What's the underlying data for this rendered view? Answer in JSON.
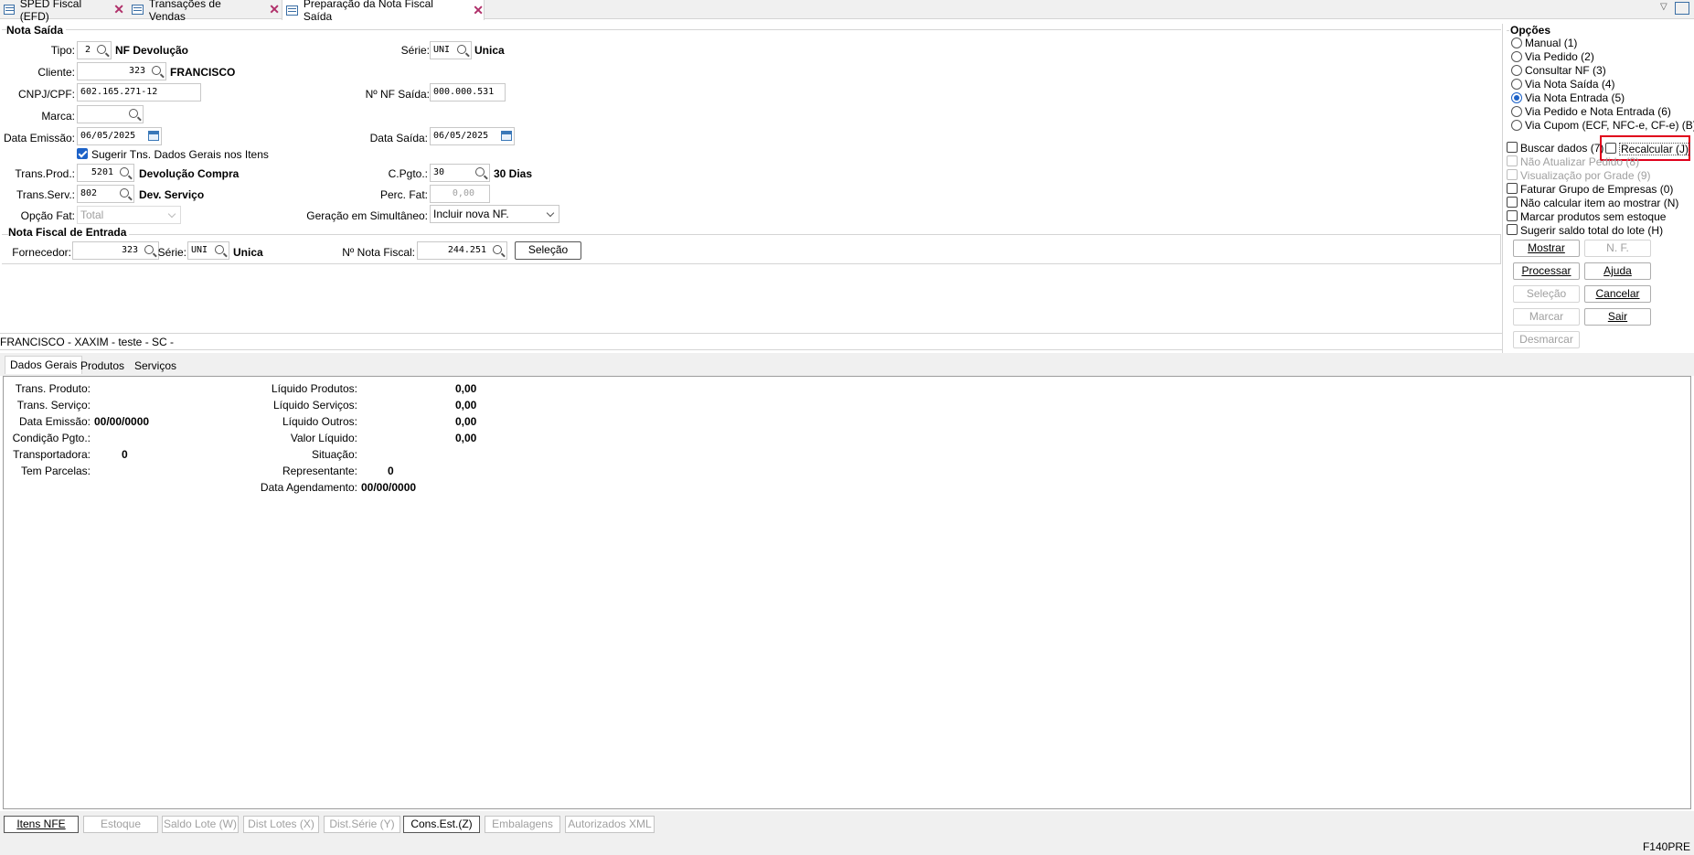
{
  "tabs": [
    {
      "label": "SPED Fiscal (EFD)"
    },
    {
      "label": "Transações de Vendas"
    },
    {
      "label": "Preparação da Nota Fiscal Saída"
    }
  ],
  "nota_saida": {
    "title": "Nota Saída",
    "tipo_label": "Tipo:",
    "tipo_value": "2",
    "tipo_desc": "NF Devolução",
    "serie_label": "Série:",
    "serie_value": "UNI",
    "serie_desc": "Unica",
    "cliente_label": "Cliente:",
    "cliente_value": "323",
    "cliente_desc": "FRANCISCO",
    "cnpj_label": "CNPJ/CPF:",
    "cnpj_value": "602.165.271-12",
    "nf_saida_label": "Nº NF Saída:",
    "nf_saida_value": "000.000.531",
    "marca_label": "Marca:",
    "marca_value": "",
    "data_emissao_label": "Data Emissão:",
    "data_emissao_value": "06/05/2025",
    "data_saida_label": "Data Saída:",
    "data_saida_value": "06/05/2025",
    "sugerir_label": "Sugerir Tns. Dados Gerais nos Itens",
    "trans_prod_label": "Trans.Prod.:",
    "trans_prod_value": "5201",
    "trans_prod_desc": "Devolução Compra",
    "cpgto_label": "C.Pgto.:",
    "cpgto_value": "30",
    "cpgto_desc": "30 Dias",
    "trans_serv_label": "Trans.Serv.:",
    "trans_serv_value": "802",
    "trans_serv_desc": "Dev. Serviço",
    "perc_fat_label": "Perc. Fat:",
    "perc_fat_value": "0,00",
    "opcao_fat_label": "Opção Fat:",
    "opcao_fat_value": "Total",
    "geracao_label": "Geração em Simultâneo:",
    "geracao_value": "Incluir nova NF."
  },
  "nota_entrada": {
    "title": "Nota Fiscal de Entrada",
    "fornecedor_label": "Fornecedor:",
    "fornecedor_value": "323",
    "serie_label": "Série:",
    "serie_value": "UNI",
    "serie_desc": "Unica",
    "nota_fiscal_label": "Nº Nota Fiscal:",
    "nota_fiscal_value": "244.251",
    "selecao_button": "Seleção"
  },
  "status_line": "FRANCISCO - XAXIM - teste - SC -",
  "opcoes": {
    "title": "Opções",
    "radios": [
      {
        "label": "Manual (1)",
        "checked": false
      },
      {
        "label": "Via Pedido (2)",
        "checked": false
      },
      {
        "label": "Consultar NF (3)",
        "checked": false
      },
      {
        "label": "Via Nota Saída (4)",
        "checked": false
      },
      {
        "label": "Via Nota Entrada (5)",
        "checked": true
      },
      {
        "label": "Via Pedido e Nota Entrada (6)",
        "checked": false
      },
      {
        "label": "Via Cupom (ECF, NFC-e, CF-e) (B)",
        "checked": false
      }
    ],
    "buscar_dados": "Buscar dados (7)",
    "recalcular": "Recalcular (J)",
    "nao_atualizar": "Não Atualizar Pedido (8)",
    "visualizacao": "Visualização por Grade (9)",
    "faturar_grupo": "Faturar Grupo de Empresas (0)",
    "nao_calcular": "Não calcular item ao mostrar (N)",
    "marcar_produtos": "Marcar produtos sem estoque",
    "sugerir_saldo": "Sugerir saldo total do lote (H)",
    "highlight_color": "#e0001b"
  },
  "actions": {
    "mostrar": "Mostrar",
    "nf": "N. F.",
    "processar": "Processar",
    "ajuda": "Ajuda",
    "selecao": "Seleção",
    "cancelar": "Cancelar",
    "marcar": "Marcar",
    "sair": "Sair",
    "desmarcar": "Desmarcar"
  },
  "inner_tabs": [
    {
      "label": "Dados Gerais"
    },
    {
      "label": "Produtos"
    },
    {
      "label": "Serviços"
    }
  ],
  "dados_gerais": {
    "trans_produto_label": "Trans. Produto:",
    "trans_produto_value": "",
    "trans_servico_label": "Trans. Serviço:",
    "trans_servico_value": "",
    "data_emissao_label": "Data Emissão:",
    "data_emissao_value": "00/00/0000",
    "condicao_label": "Condição Pgto.:",
    "condicao_value": "",
    "transportadora_label": "Transportadora:",
    "transportadora_value": "0",
    "tem_parcelas_label": "Tem Parcelas:",
    "tem_parcelas_value": "",
    "liquido_produtos_label": "Líquido Produtos:",
    "liquido_produtos_value": "0,00",
    "liquido_servicos_label": "Líquido Serviços:",
    "liquido_servicos_value": "0,00",
    "liquido_outros_label": "Líquido Outros:",
    "liquido_outros_value": "0,00",
    "valor_liquido_label": "Valor Líquido:",
    "valor_liquido_value": "0,00",
    "situacao_label": "Situação:",
    "situacao_value": "",
    "representante_label": "Representante:",
    "representante_value": "0",
    "data_agendamento_label": "Data Agendamento:",
    "data_agendamento_value": "00/00/0000"
  },
  "bottom_buttons": [
    {
      "label": "Itens NFE",
      "enabled": true
    },
    {
      "label": "Estoque",
      "enabled": false
    },
    {
      "label": "Saldo Lote (W)",
      "enabled": false
    },
    {
      "label": "Dist Lotes (X)",
      "enabled": false
    },
    {
      "label": "Dist.Série (Y)",
      "enabled": false
    },
    {
      "label": "Cons.Est.(Z)",
      "enabled": true
    },
    {
      "label": "Embalagens",
      "enabled": false
    },
    {
      "label": "Autorizados XML",
      "enabled": false
    }
  ],
  "footer_code": "F140PRE"
}
